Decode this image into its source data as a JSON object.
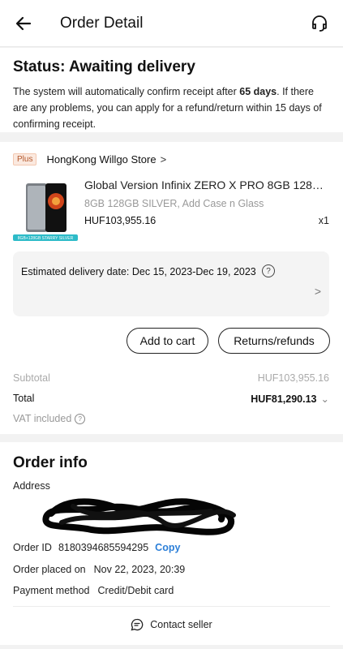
{
  "header": {
    "title": "Order Detail",
    "back_icon": "arrow-left-icon",
    "support_icon": "headset-icon"
  },
  "status": {
    "title": "Status: Awaiting delivery",
    "line_prefix": "The system will automatically confirm receipt after ",
    "days": "65 days",
    "line_suffix": ". If there are any problems, you can apply for a refund/return within 15 days of confirming receipt."
  },
  "store": {
    "badge": "Plus",
    "name": "HongKong Willgo Store",
    "chevron": ">"
  },
  "product": {
    "name": "Global Version Infinix ZERO X PRO 8GB 128GB...",
    "variant": "8GB 128GB SILVER, Add Case n Glass",
    "price": "HUF103,955.16",
    "quantity": "x1",
    "image_tag": "8GB+128GB STARRY SILVER"
  },
  "delivery": {
    "text": "Estimated delivery date: Dec 15, 2023-Dec 19, 2023",
    "help": "?",
    "chevron": ">"
  },
  "buttons": {
    "add_to_cart": "Add to cart",
    "returns": "Returns/refunds"
  },
  "summary": {
    "subtotal_label": "Subtotal",
    "subtotal_value": "HUF103,955.16",
    "total_label": "Total",
    "total_value": "HUF81,290.13",
    "vat_label": "VAT included",
    "vat_help": "?"
  },
  "order_info": {
    "title": "Order info",
    "address_label": "Address",
    "order_id_label": "Order ID",
    "order_id_value": "8180394685594295",
    "copy": "Copy",
    "placed_label": "Order placed on",
    "placed_value": "Nov 22, 2023, 20:39",
    "payment_label": "Payment method",
    "payment_value": "Credit/Debit card",
    "contact": "Contact seller"
  },
  "colors": {
    "accent": "#2c7fd8",
    "background": "#f2f2f2",
    "plus_badge": "#b3572b"
  }
}
